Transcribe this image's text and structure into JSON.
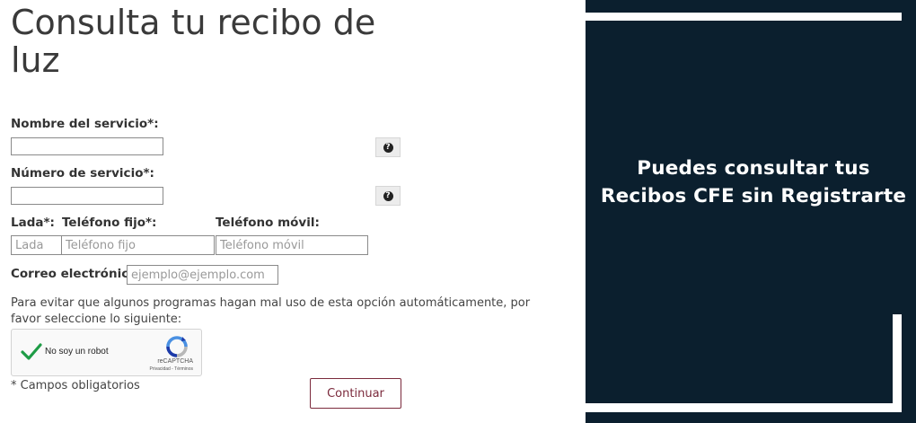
{
  "form": {
    "title": "Consulta tu recibo de luz",
    "nombre_label": "Nombre del servicio*:",
    "numero_label": "Número de servicio*:",
    "lada_label": "Lada*:",
    "fijo_label": "Teléfono fijo*:",
    "movil_label": "Teléfono móvil:",
    "lada_placeholder": "Lada",
    "fijo_placeholder": "Teléfono fijo",
    "movil_placeholder": "Teléfono móvil",
    "correo_label": "Correo electrónico*:",
    "correo_placeholder": "ejemplo@ejemplo.com",
    "help_glyph": "?",
    "note": "Para evitar que algunos programas hagan mal uso de esta opción automáticamente, por favor seleccione lo siguiente:",
    "required_note": "* Campos obligatorios",
    "continue_label": "Continuar"
  },
  "captcha": {
    "label": "No soy un robot",
    "brand": "reCAPTCHA",
    "terms": "Privacidad - Términos",
    "checked": true,
    "icon": "recaptcha-logo-icon"
  },
  "banner": {
    "text": "Puedes consultar tus Recibos CFE sin Registrarte"
  },
  "colors": {
    "banner_bg": "#0b1f2e",
    "button_accent": "#7b2a3c",
    "check_green": "#1e9c46"
  }
}
